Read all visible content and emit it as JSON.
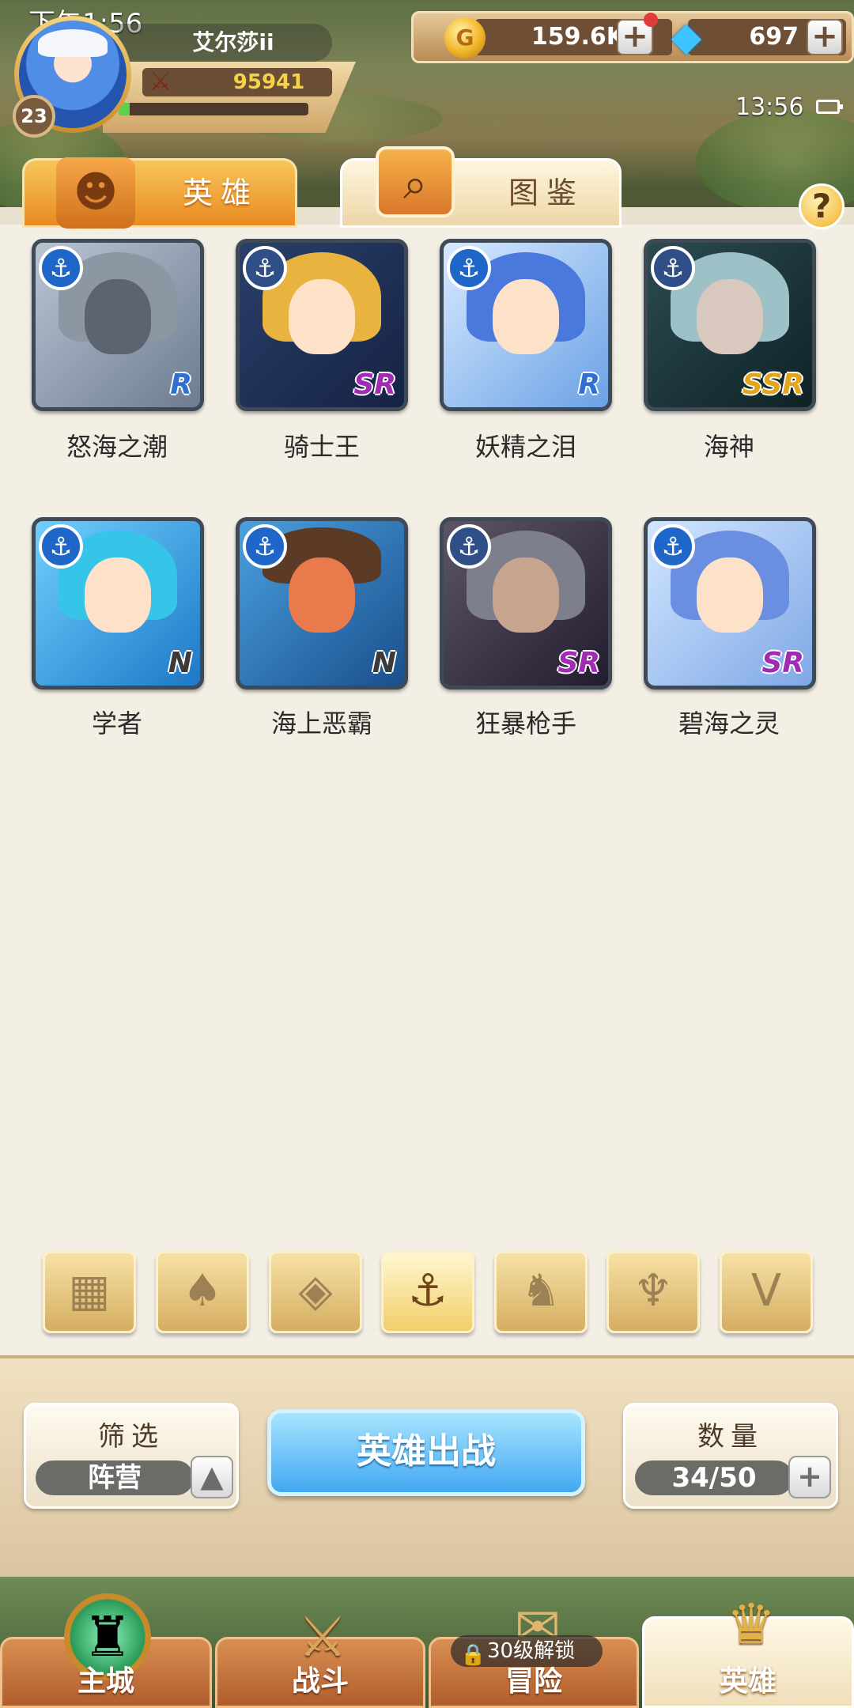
{
  "status_bar": {
    "system_time": "下午1:56",
    "clock": "13:56"
  },
  "player": {
    "name": "艾尔莎ii",
    "level": "23",
    "power": "95941",
    "exp_fraction": 0.06
  },
  "resources": {
    "gold": "159.6K",
    "diamonds": "697"
  },
  "tabs": [
    {
      "label": "英雄",
      "active": true,
      "icon": "helmet-icon"
    },
    {
      "label": "图鉴",
      "active": false,
      "icon": "magnifier-icon"
    }
  ],
  "help_label": "?",
  "heroes": [
    {
      "name": "怒海之潮",
      "rarity": "R"
    },
    {
      "name": "骑士王",
      "rarity": "SR"
    },
    {
      "name": "妖精之泪",
      "rarity": "R"
    },
    {
      "name": "海神",
      "rarity": "SSR"
    },
    {
      "name": "学者",
      "rarity": "N"
    },
    {
      "name": "海上恶霸",
      "rarity": "N"
    },
    {
      "name": "狂暴枪手",
      "rarity": "SR"
    },
    {
      "name": "碧海之灵",
      "rarity": "SR"
    }
  ],
  "faction_filters": [
    {
      "icon": "grid-icon",
      "glyph": "▦",
      "active": false
    },
    {
      "icon": "leaf-faction-icon",
      "glyph": "♠",
      "active": false
    },
    {
      "icon": "diamond-faction-icon",
      "glyph": "◈",
      "active": false
    },
    {
      "icon": "anchor-faction-icon",
      "glyph": "⚓",
      "active": true
    },
    {
      "icon": "beast-faction-icon",
      "glyph": "♞",
      "active": false
    },
    {
      "icon": "demon-faction-icon",
      "glyph": "♆",
      "active": false
    },
    {
      "icon": "wing-faction-icon",
      "glyph": "V",
      "active": false
    }
  ],
  "filter_box": {
    "title": "筛选",
    "value": "阵营",
    "button": "▲"
  },
  "deploy_button": "英雄出战",
  "count_box": {
    "title": "数量",
    "value": "34/50",
    "button": "+"
  },
  "bottom_nav": [
    {
      "label": "主城",
      "icon": "castle-icon",
      "active": false
    },
    {
      "label": "战斗",
      "icon": "crossed-swords-icon",
      "active": false
    },
    {
      "label": "冒险",
      "icon": "map-scroll-icon",
      "active": false,
      "lock_text": "30级解锁"
    },
    {
      "label": "英雄",
      "icon": "hero-helmet-icon",
      "active": true
    }
  ],
  "colors": {
    "accent_blue": "#42a8f0",
    "tab_orange": "#e88b22",
    "paper": "#f3efe5"
  }
}
